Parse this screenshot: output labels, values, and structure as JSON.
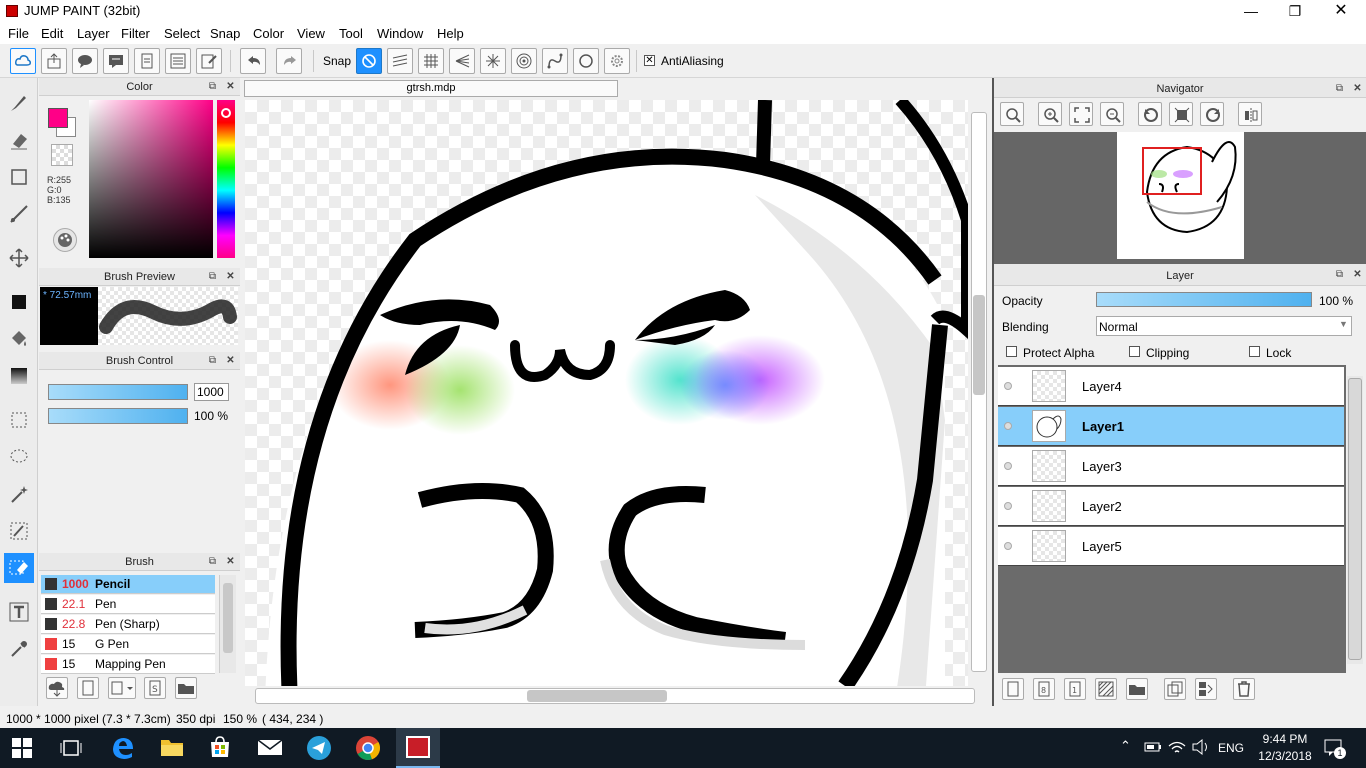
{
  "window": {
    "title": "JUMP PAINT (32bit)"
  },
  "menu": [
    "File",
    "Edit",
    "Layer",
    "Filter",
    "Select",
    "Snap",
    "Color",
    "View",
    "Tool",
    "Window",
    "Help"
  ],
  "toolbar": {
    "snap_label": "Snap",
    "antialiasing_label": "AntiAliasing",
    "antialiasing_checked": true
  },
  "document": {
    "tab": "gtrsh.mdp"
  },
  "color_panel": {
    "title": "Color",
    "r": "R:255",
    "g": "G:0",
    "b": "B:135",
    "foreground": "#ff0087"
  },
  "brush_preview": {
    "title": "Brush Preview",
    "size": "* 72.57mm"
  },
  "brush_control": {
    "title": "Brush Control",
    "size_value": "1000",
    "opacity_value": "100 %"
  },
  "brush_panel": {
    "title": "Brush",
    "items": [
      {
        "size": "1000",
        "name": "Pencil",
        "selected": true,
        "color": "#333333"
      },
      {
        "size": "22.1",
        "name": "Pen",
        "selected": false,
        "color": "#333333"
      },
      {
        "size": "22.8",
        "name": "Pen (Sharp)",
        "selected": false,
        "color": "#333333"
      },
      {
        "size": "15",
        "name": "G Pen",
        "selected": false,
        "color": "#ef4040"
      },
      {
        "size": "15",
        "name": "Mapping Pen",
        "selected": false,
        "color": "#ef4040"
      }
    ]
  },
  "navigator": {
    "title": "Navigator"
  },
  "layer_panel": {
    "title": "Layer",
    "opacity_label": "Opacity",
    "opacity_value": "100 %",
    "opacity_fraction": 1.0,
    "blending_label": "Blending",
    "blending_value": "Normal",
    "protect_alpha": "Protect Alpha",
    "clipping": "Clipping",
    "lock": "Lock",
    "layers": [
      {
        "name": "Layer4",
        "selected": false
      },
      {
        "name": "Layer1",
        "selected": true
      },
      {
        "name": "Layer3",
        "selected": false
      },
      {
        "name": "Layer2",
        "selected": false
      },
      {
        "name": "Layer5",
        "selected": false
      }
    ]
  },
  "status": {
    "size": "1000 * 1000 pixel",
    "cm": "(7.3 * 7.3cm)",
    "dpi": "350 dpi",
    "zoom": "150 %",
    "coords": "( 434, 234 )"
  },
  "taskbar": {
    "lang": "ENG",
    "time": "9:44 PM",
    "date": "12/3/2018",
    "notifications": "1"
  }
}
